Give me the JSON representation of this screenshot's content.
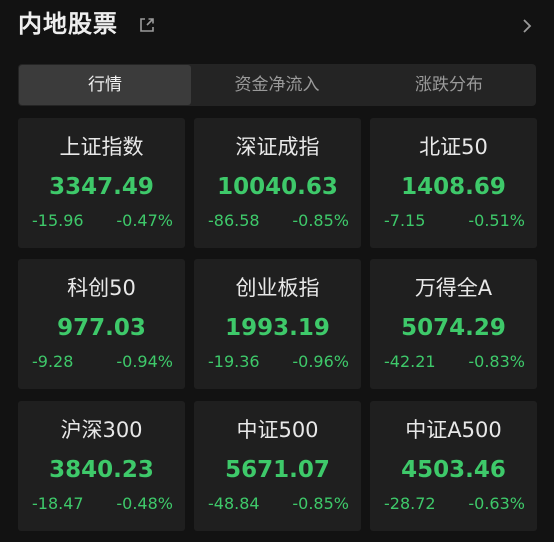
{
  "header": {
    "title": "内地股票",
    "share_icon": "external-link-icon",
    "more_icon": "chevron-right-icon"
  },
  "tabs": [
    {
      "label": "行情",
      "active": true
    },
    {
      "label": "资金净流入",
      "active": false
    },
    {
      "label": "涨跌分布",
      "active": false
    }
  ],
  "colors": {
    "down": "#3ec96a",
    "background": "#121212",
    "card": "#1f1f1f"
  },
  "indices": [
    {
      "name": "上证指数",
      "value": "3347.49",
      "change": "-15.96",
      "pct": "-0.47%"
    },
    {
      "name": "深证成指",
      "value": "10040.63",
      "change": "-86.58",
      "pct": "-0.85%"
    },
    {
      "name": "北证50",
      "value": "1408.69",
      "change": "-7.15",
      "pct": "-0.51%"
    },
    {
      "name": "科创50",
      "value": "977.03",
      "change": "-9.28",
      "pct": "-0.94%"
    },
    {
      "name": "创业板指",
      "value": "1993.19",
      "change": "-19.36",
      "pct": "-0.96%"
    },
    {
      "name": "万得全A",
      "value": "5074.29",
      "change": "-42.21",
      "pct": "-0.83%"
    },
    {
      "name": "沪深300",
      "value": "3840.23",
      "change": "-18.47",
      "pct": "-0.48%"
    },
    {
      "name": "中证500",
      "value": "5671.07",
      "change": "-48.84",
      "pct": "-0.85%"
    },
    {
      "name": "中证A500",
      "value": "4503.46",
      "change": "-28.72",
      "pct": "-0.63%"
    }
  ]
}
